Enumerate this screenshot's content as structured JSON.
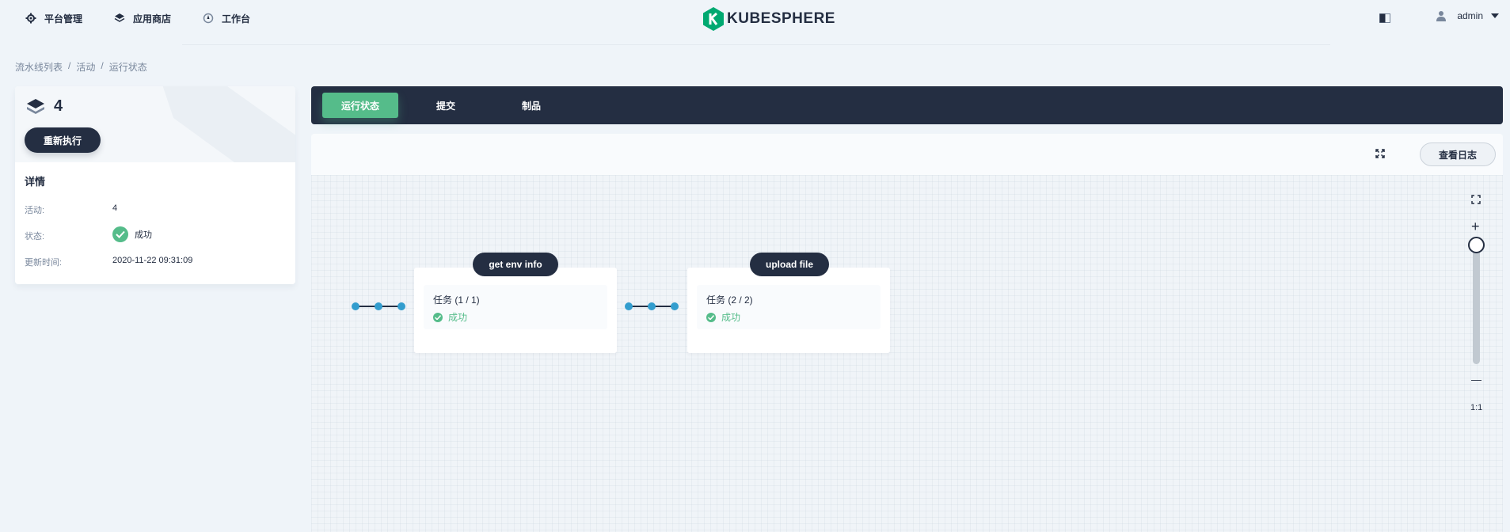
{
  "nav": {
    "platform": "平台管理",
    "appstore": "应用商店",
    "workbench": "工作台",
    "logo": "KUBESPHERE",
    "user": "admin"
  },
  "breadcrumb": [
    "流水线列表",
    "活动",
    "运行状态"
  ],
  "run": {
    "number": "4",
    "rerun_label": "重新执行",
    "detail_title": "详情",
    "activity_label": "活动:",
    "activity_value": "4",
    "status_label": "状态:",
    "status_value": "成功",
    "updated_label": "更新时间:",
    "updated_value": "2020-11-22 09:31:09"
  },
  "tabs": [
    "运行状态",
    "提交",
    "制品"
  ],
  "toolbar": {
    "viewlog": "查看日志"
  },
  "stages": [
    {
      "name": "get env info",
      "task": "任务 (1 / 1)",
      "status": "成功"
    },
    {
      "name": "upload file",
      "task": "任务 (2 / 2)",
      "status": "成功"
    }
  ],
  "zoom": {
    "plus": "+",
    "minus": "—",
    "ratio": "1:1",
    "level": 1.0
  },
  "colors": {
    "accent": "#55bc8a",
    "dark": "#242e42",
    "link": "#329dce"
  }
}
